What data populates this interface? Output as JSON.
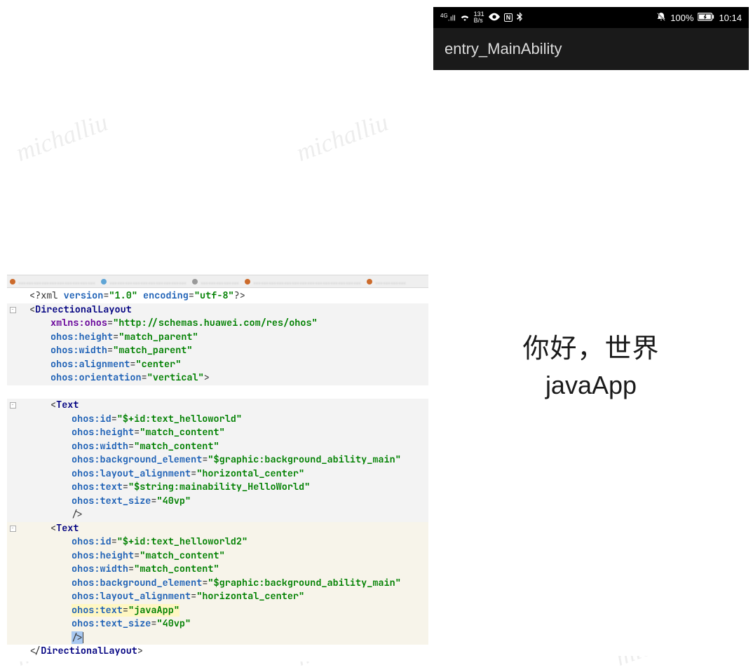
{
  "watermark": "michalliu",
  "phone": {
    "status": {
      "network_gen": "4G",
      "net_rate_top": "131",
      "net_rate_unit": "B/s",
      "battery_text": "100%",
      "time": "10:14"
    },
    "appbar_title": "entry_MainAbility",
    "text1": "你好，世界",
    "text2": "javaApp"
  },
  "editor": {
    "tabs": [
      {
        "label": "…"
      },
      {
        "label": "…"
      },
      {
        "label": "…"
      },
      {
        "label": "…"
      },
      {
        "label": "…"
      }
    ],
    "code": {
      "xml_decl_pre": "<?xml ",
      "xml_decl_ver_k": "version",
      "xml_decl_ver_v": "\"1.0\"",
      "xml_decl_enc_k": "encoding",
      "xml_decl_enc_v": "\"utf-8\"",
      "xml_decl_post": "?>",
      "root_open": "<",
      "root_tag": "DirectionalLayout",
      "root_close_open": "</",
      "root_close_tag": "DirectionalLayout",
      "root_close_end": ">",
      "attr_xmlns_k": "xmlns:ohos",
      "attr_xmlns_v": "\"http://schemas.huawei.com/res/ohos\"",
      "attr_height_k": "ohos:height",
      "attr_height_v_parent": "\"match_parent\"",
      "attr_width_k": "ohos:width",
      "attr_width_v_parent": "\"match_parent\"",
      "attr_alignment_k": "ohos:alignment",
      "attr_alignment_v": "\"center\"",
      "attr_orientation_k": "ohos:orientation",
      "attr_orientation_v": "\"vertical\"",
      "tag_text_open": "<",
      "tag_text": "Text",
      "attr_id_k": "ohos:id",
      "attr_id_v1": "\"$+id:text_helloworld\"",
      "attr_id_v2": "\"$+id:text_helloworld2\"",
      "attr_heightc_v": "\"match_content\"",
      "attr_widthc_v": "\"match_content\"",
      "attr_bg_k": "ohos:background_element",
      "attr_bg_v": "\"$graphic:background_ability_main\"",
      "attr_la_k": "ohos:layout_alignment",
      "attr_la_v": "\"horizontal_center\"",
      "attr_text_k": "ohos:text",
      "attr_text_v1": "\"$string:mainability_HelloWorld\"",
      "attr_text_v2": "\"javaApp\"",
      "attr_ts_k": "ohos:text_size",
      "attr_ts_v": "\"40vp\"",
      "self_close": "/>",
      "gt": ">"
    }
  }
}
